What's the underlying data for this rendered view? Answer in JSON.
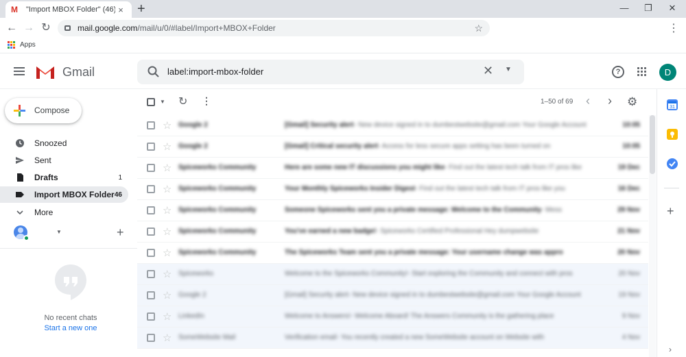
{
  "browser": {
    "tab_title": "\"Import MBOX Folder\" (46) -",
    "tab_close": "×",
    "new_tab": "+",
    "url_host": "mail.google.com",
    "url_path": "/mail/u/0/#label/Import+MBOX+Folder",
    "bookmark_apps": "Apps",
    "window_min": "—",
    "window_restore": "❐",
    "window_close": "✕"
  },
  "gmail": {
    "logo_text": "Gmail",
    "search_query": "label:import-mbox-folder",
    "avatar_letter": "D",
    "compose_label": "Compose"
  },
  "sidebar": {
    "items": [
      {
        "label": "Snoozed",
        "count": "",
        "icon": "clock-icon"
      },
      {
        "label": "Sent",
        "count": "",
        "icon": "send-icon"
      },
      {
        "label": "Drafts",
        "count": "1",
        "icon": "draft-icon"
      },
      {
        "label": "Import MBOX Folder",
        "count": "46",
        "icon": "label-icon"
      },
      {
        "label": "More",
        "count": "",
        "icon": "chevron-down-icon"
      }
    ]
  },
  "hangouts": {
    "no_recent": "No recent chats",
    "start_new": "Start a new one"
  },
  "toolbar": {
    "range": "1–50 of 69"
  },
  "mails": [
    {
      "sender": "Google 2",
      "subject": "[Gmail] Security alert",
      "snippet": " - New device signed in to dumbestwebsite@gmail.com Your Google Account",
      "date": "10:05",
      "unread": true
    },
    {
      "sender": "Google 2",
      "subject": "[Gmail] Critical security alert",
      "snippet": " - Access for less secure apps setting has been turned on",
      "date": "10:05",
      "unread": true
    },
    {
      "sender": "Spiceworks Community",
      "subject": "Here are some new IT discussions you might like",
      "snippet": " - Find out the latest tech talk from IT pros like",
      "date": "19 Dec",
      "unread": true
    },
    {
      "sender": "Spiceworks Community",
      "subject": "Your Monthly Spiceworks Insider Digest",
      "snippet": " - Find out the latest tech talk from IT pros like you",
      "date": "16 Dec",
      "unread": true
    },
    {
      "sender": "Spiceworks Community",
      "subject": "Someone Spiceworks sent you a private message: Welcome to the Community",
      "snippet": " - Mess",
      "date": "29 Nov",
      "unread": true
    },
    {
      "sender": "Spiceworks Community",
      "subject": "You've earned a new badge!",
      "snippet": " - Spiceworks Certified Professional Hey dumpwebsite",
      "date": "21 Nov",
      "unread": true
    },
    {
      "sender": "Spiceworks Community",
      "subject": "The Spiceworks Team sent you a private message: Your username change was appro",
      "snippet": "",
      "date": "20 Nov",
      "unread": true
    },
    {
      "sender": "Spiceworks",
      "subject": "Welcome to the Spiceworks Community!",
      "snippet": " - Start exploring the Community and connect with pros",
      "date": "20 Nov",
      "unread": false
    },
    {
      "sender": "Google 2",
      "subject": "[Gmail] Security alert",
      "snippet": " - New device signed in to dumbestwebsite@gmail.com Your Google Account",
      "date": "19 Nov",
      "unread": false
    },
    {
      "sender": "LinkedIn",
      "subject": "Welcome to Answers!",
      "snippet": " - Welcome Aboard! The Answers Community is the gathering place",
      "date": "9 Nov",
      "unread": false
    },
    {
      "sender": "SomeWebsite Mail",
      "subject": "Verification email",
      "snippet": " - You recently created a new SomeWebsite account on Website with",
      "date": "4 Nov",
      "unread": false
    }
  ]
}
